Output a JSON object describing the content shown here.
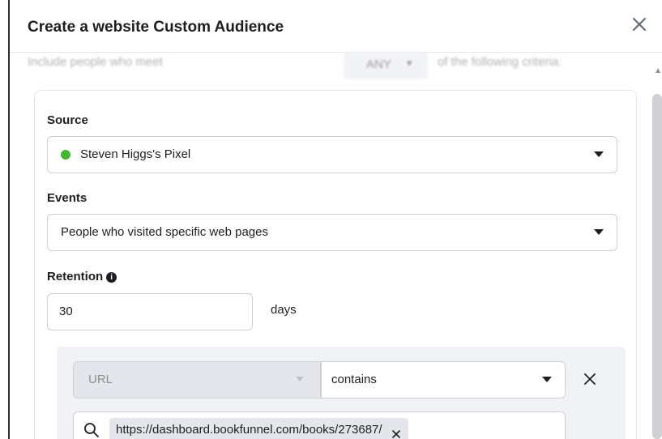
{
  "dialog": {
    "title": "Create a website Custom Audience",
    "faded_left": "Include people who meet",
    "faded_select": "ANY",
    "faded_right": "of the following criteria:"
  },
  "source": {
    "label": "Source",
    "value": "Steven Higgs's Pixel",
    "status_color": "#42b72a"
  },
  "events": {
    "label": "Events",
    "value": "People who visited specific web pages"
  },
  "retention": {
    "label": "Retention",
    "value": "30",
    "unit": "days"
  },
  "rule": {
    "field": "URL",
    "operator": "contains",
    "token": "https://dashboard.bookfunnel.com/books/273687/"
  }
}
